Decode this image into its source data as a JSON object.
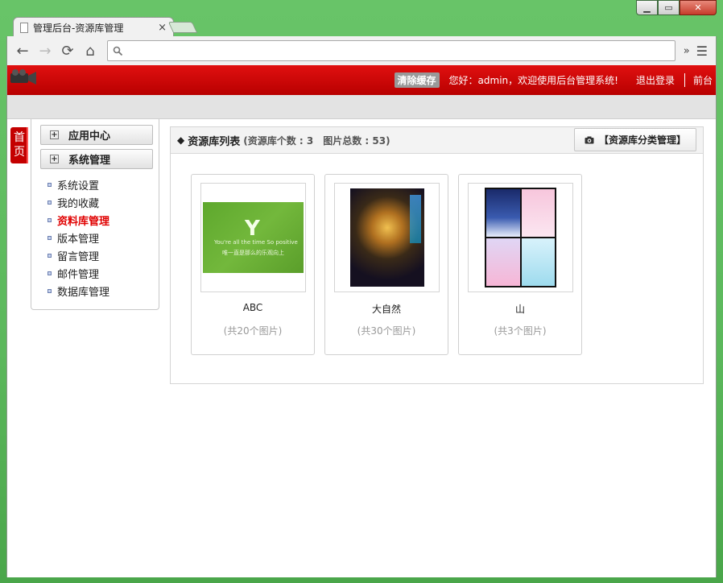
{
  "browser": {
    "tab_title": "管理后台-资源库管理",
    "tab_close": "×",
    "nav": {
      "back": "←",
      "forward": "→",
      "reload": "⟳",
      "home": "⌂"
    },
    "address_value": "",
    "overflow": "»",
    "menu": "☰"
  },
  "window_controls": {
    "minimize": "▁",
    "maximize": "▭",
    "close": "✕"
  },
  "header": {
    "clear_cache": "清除缓存",
    "greeting": "您好：admin，欢迎使用后台管理系统!",
    "logout": "退出登录",
    "frontend": "前台"
  },
  "home_tab": "首页",
  "sidebar": {
    "sections": [
      {
        "label": "应用中心",
        "icon": "+"
      },
      {
        "label": "系统管理",
        "icon": "+"
      }
    ],
    "items": [
      {
        "label": "系统设置"
      },
      {
        "label": "我的收藏"
      },
      {
        "label": "资料库管理",
        "active": true
      },
      {
        "label": "版本管理"
      },
      {
        "label": "留言管理"
      },
      {
        "label": "邮件管理"
      },
      {
        "label": "数据库管理"
      }
    ]
  },
  "main": {
    "title_marker": "◆",
    "title": "资源库列表",
    "stats": "(资源库个数 : 3　图片总数 : 53)",
    "category_button": "【资源库分类管理】",
    "cards": [
      {
        "name": "ABC",
        "count": "(共20个图片)",
        "thumb_text_big": "Y",
        "thumb_text_1": "You're all the time So positive",
        "thumb_text_2": "唯一直是那么的乐观向上"
      },
      {
        "name": "大自然",
        "count": "(共30个图片)"
      },
      {
        "name": "山",
        "count": "(共3个图片)"
      }
    ]
  },
  "colors": {
    "header_red": "#c80000",
    "active_red": "#e00000",
    "window_green": "#5cb85c"
  }
}
